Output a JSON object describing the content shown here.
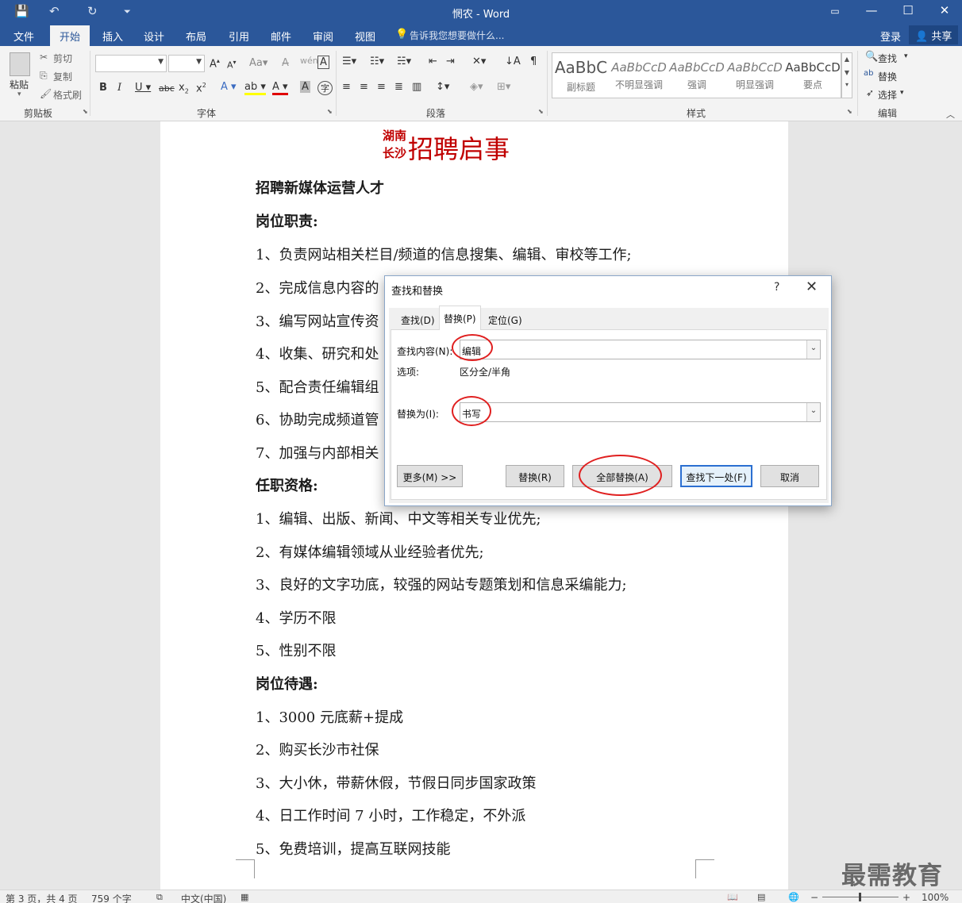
{
  "window": {
    "title": "惘农 - Word",
    "controls": [
      "▭",
      "—",
      "☐",
      "✕"
    ]
  },
  "quick_access": [
    "💾",
    "↶",
    "↻",
    "⏷"
  ],
  "ribbon_tabs": [
    "文件",
    "开始",
    "插入",
    "设计",
    "布局",
    "引用",
    "邮件",
    "审阅",
    "视图"
  ],
  "active_tab": "开始",
  "tell_me": "告诉我您想要做什么...",
  "account": {
    "login": "登录",
    "share": "共享"
  },
  "clipboard": {
    "paste": "粘贴",
    "cut": "剪切",
    "copy": "复制",
    "format_painter": "格式刷",
    "label": "剪贴板"
  },
  "font_group": {
    "label": "字体",
    "font_name": "",
    "font_size": ""
  },
  "paragraph_group": {
    "label": "段落"
  },
  "styles_group": {
    "label": "样式",
    "items": [
      {
        "sample": "AaBbC",
        "name": "副标题"
      },
      {
        "sample": "AaBbCcD",
        "name": "不明显强调"
      },
      {
        "sample": "AaBbCcD",
        "name": "强调"
      },
      {
        "sample": "AaBbCcD",
        "name": "明显强调"
      },
      {
        "sample": "AaBbCcD",
        "name": "要点"
      }
    ]
  },
  "editing_group": {
    "label": "编辑",
    "find": "查找",
    "replace": "替换",
    "select": "选择"
  },
  "document": {
    "title_small_1": "湖南",
    "title_small_2": "长沙",
    "title_big": "招聘启事",
    "lines": [
      "招聘新媒体运营人才",
      "岗位职责:",
      "1、负责网站相关栏目/频道的信息搜集、编辑、审校等工作;",
      "2、完成信息内容的",
      "3、编写网站宣传资",
      "4、收集、研究和处",
      "5、配合责任编辑组",
      "6、协助完成频道管",
      "7、加强与内部相关",
      "任职资格:",
      "1、编辑、出版、新闻、中文等相关专业优先;",
      "2、有媒体编辑领域从业经验者优先;",
      "3、良好的文字功底，较强的网站专题策划和信息采编能力;",
      "4、学历不限",
      "5、性别不限",
      "岗位待遇:",
      "1、3000 元底薪+提成",
      "2、购买长沙市社保",
      "3、大小休，带薪休假，节假日同步国家政策",
      "4、日工作时间 7 小时，工作稳定，不外派",
      "5、免费培训，提高互联网技能"
    ]
  },
  "dialog": {
    "title": "查找和替换",
    "help": "?",
    "close": "✕",
    "tabs": [
      "查找(D)",
      "替换(P)",
      "定位(G)"
    ],
    "active_tab": "替换(P)",
    "find_label": "查找内容(N):",
    "find_value": "编辑",
    "options_label": "选项:",
    "options_value": "区分全/半角",
    "replace_label": "替换为(I):",
    "replace_value": "书写",
    "buttons": {
      "more": "更多(M) >>",
      "replace": "替换(R)",
      "replace_all": "全部替换(A)",
      "find_next": "查找下一处(F)",
      "cancel": "取消"
    }
  },
  "status_bar": {
    "page": "第 3 页，共 4 页",
    "words": "759 个字",
    "language": "中文(中国)",
    "zoom": "100%"
  },
  "watermark": "最需教育",
  "colors": {
    "accent": "#2b579a",
    "title_red": "#c00000",
    "highlight_circle": "#e02020"
  }
}
